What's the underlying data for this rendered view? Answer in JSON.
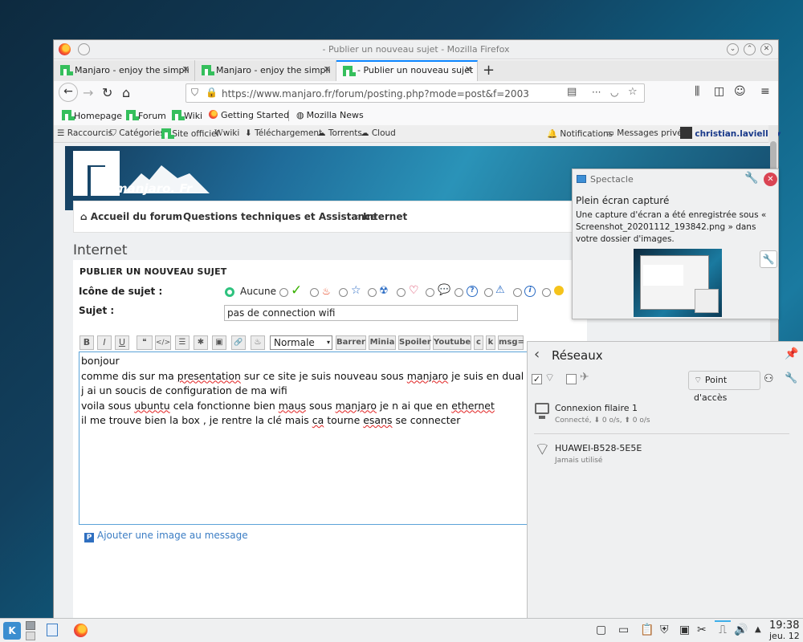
{
  "window": {
    "title": "- Publier un nouveau sujet - Mozilla Firefox"
  },
  "tabs": [
    {
      "label": "Manjaro - enjoy the simpli",
      "active": false
    },
    {
      "label": "Manjaro - enjoy the simpli",
      "active": false
    },
    {
      "label": "- Publier un nouveau sujet",
      "active": true
    }
  ],
  "urlbar": {
    "url": "https://www.manjaro.fr/forum/posting.php?mode=post&f=2003",
    "more": "···"
  },
  "bookmarks": [
    {
      "label": "Homepage"
    },
    {
      "label": "Forum"
    },
    {
      "label": "Wiki"
    },
    {
      "label": "Getting Started"
    },
    {
      "label": "Mozilla News"
    }
  ],
  "sitebar": {
    "raccourcis": "Raccourcis",
    "categories": "Catégories",
    "site_officiel": "Site officiel",
    "wiki_prefix": "W",
    "wiki": "wiki",
    "telechargement": "Téléchargement",
    "torrents": "Torrents",
    "cloud": "Cloud",
    "notifications": "Notifications",
    "messages": "Messages privés",
    "user": "christian.lavielle"
  },
  "banner": {
    "logo_text": "manjaro. Fr"
  },
  "breadcrumb": {
    "home": "Accueil du forum",
    "section": "Questions techniques et Assistance",
    "current": "Internet"
  },
  "page": {
    "heading": "Internet",
    "form_title": "PUBLIER UN NOUVEAU SUJET",
    "icon_label": "Icône de sujet :",
    "icon_none": "Aucune",
    "subject_label": "Sujet :",
    "subject_value": "pas de connection wifi",
    "format_select": "Normale",
    "add_image": "Ajouter une image au message"
  },
  "toolbar": {
    "bold": "B",
    "italic": "I",
    "underline": "U",
    "quote": "❝",
    "code": "</>",
    "list": "☰",
    "star": "✱",
    "image": "▣",
    "link": "🔗",
    "drop": "♨",
    "barrer": "Barrer",
    "minia": "Minia",
    "spoiler": "Spoiler",
    "youtube": "Youtube",
    "c": "c",
    "k": "k",
    "msg": "msg="
  },
  "editor": {
    "line1": "bonjour",
    "line2_a": "comme dis sur ma ",
    "line2_b": "presentation",
    "line2_c": " sur ce site je suis nouveau sous ",
    "line2_d": "manjaro",
    "line2_e": " je suis en dual boot a",
    "line3": "j ai un soucis de configuration de ma wifi",
    "line4_a": "voila sous ",
    "line4_b": "ubuntu",
    "line4_c": " cela fonctionne bien ",
    "line4_d": "maus",
    "line4_e": " sous ",
    "line4_f": "manjaro",
    "line4_g": " je n ai que en ",
    "line4_h": "ethernet",
    "line5_a": "il me trouve bien la box , je rentre la clé mais ",
    "line5_b": "ca",
    "line5_c": " tourne ",
    "line5_d": "esans",
    "line5_e": " se connecter"
  },
  "spectacle": {
    "app": "Spectacle",
    "heading": "Plein écran capturé",
    "message": "Une capture d'écran a été enregistrée sous « Screenshot_20201112_193842.png » dans votre dossier d'images."
  },
  "network": {
    "title": "Réseaux",
    "hotspot": "Point d'accès",
    "connections": [
      {
        "name": "Connexion filaire 1",
        "status": "Connecté, ⬇ 0 o/s, ⬆ 0 o/s"
      },
      {
        "name": "HUAWEI-B528-5E5E",
        "status": "Jamais utilisé"
      }
    ]
  },
  "taskbar": {
    "time": "19:38",
    "date": "jeu. 12"
  },
  "colors": {
    "accent": "#0a84ff",
    "manjaro_green": "#35bf5c",
    "link": "#3b7dc4"
  }
}
